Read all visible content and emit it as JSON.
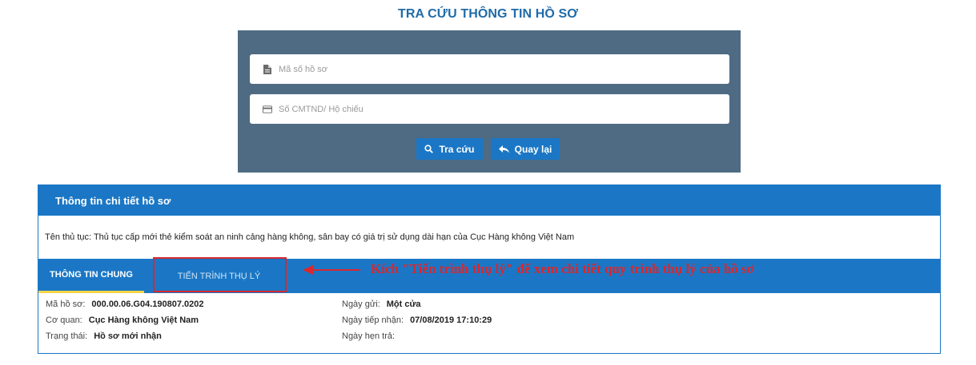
{
  "page": {
    "title": "TRA CỨU THÔNG TIN HỒ SƠ"
  },
  "search": {
    "record_placeholder": "Mã số hồ sơ",
    "id_placeholder": "Số CMTND/ Hộ chiếu",
    "search_label": "Tra cứu",
    "back_label": "Quay lại"
  },
  "detail": {
    "header": "Thông tin chi tiết hồ sơ",
    "procedure_text": "Tên thủ tục: Thủ tục cấp mới thẻ kiểm soát an ninh cảng hàng không, sân bay có giá trị sử dụng dài hạn của Cục Hàng không Việt Nam",
    "tabs": [
      {
        "label": "THÔNG TIN CHUNG",
        "active": true
      },
      {
        "label": "TIẾN TRÌNH THỤ LÝ",
        "active": false
      }
    ],
    "fields": {
      "record_no": {
        "label": "Mã hồ sơ:",
        "value": "000.00.06.G04.190807.0202"
      },
      "agency": {
        "label": "Cơ quan:",
        "value": "Cục Hàng không Việt Nam"
      },
      "status": {
        "label": "Trạng thái:",
        "value": "Hồ sơ mới nhận"
      },
      "sent_date": {
        "label": "Ngày gửi:",
        "value": "Một cửa"
      },
      "received_date": {
        "label": "Ngày tiếp nhận:",
        "value": "07/08/2019 17:10:29"
      },
      "due_date": {
        "label": "Ngày hẹn trả:",
        "value": ""
      }
    }
  },
  "annotation": {
    "text": "Kích \"Tiến trình thụ lý\" để xem chi tiết quy trình thụ lý của hồ sơ"
  },
  "colors": {
    "primary": "#1b77c5",
    "search_bg": "#4e6b83",
    "title": "#1f6ba8",
    "annotation": "#d9272e",
    "active_tab_underline": "#f5d547"
  },
  "icons": {
    "record_field": "file-icon",
    "id_field": "id-card-icon",
    "search_button": "search-icon",
    "back_button": "reply-arrow-icon"
  }
}
